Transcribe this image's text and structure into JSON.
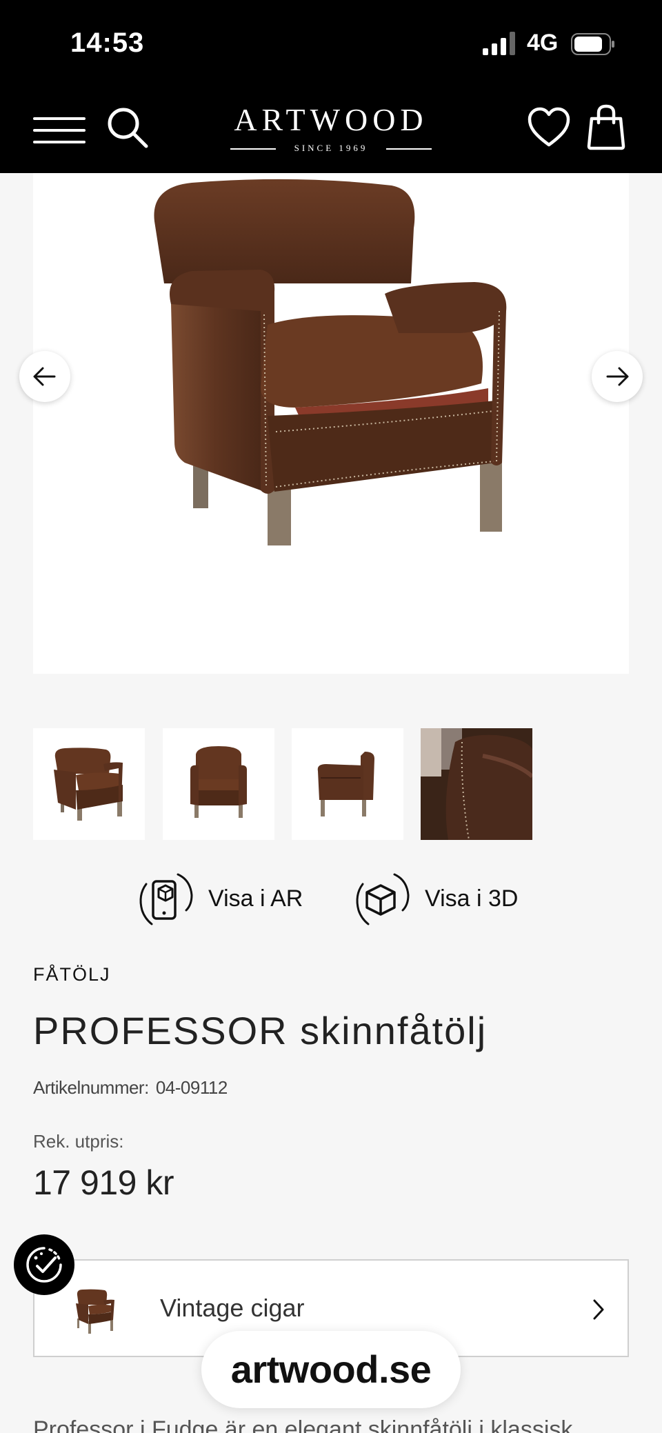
{
  "status_bar": {
    "time": "14:53",
    "network": "4G"
  },
  "header": {
    "logo_main": "ARTWOOD",
    "logo_sub": "SINCE 1969"
  },
  "gallery": {
    "thumbnail_count": 4
  },
  "view_buttons": {
    "ar_label": "Visa i AR",
    "three_d_label": "Visa i 3D"
  },
  "product": {
    "category": "FÅTÖLJ",
    "title": "PROFESSOR skinnfåtölj",
    "article_label": "Artikelnummer:",
    "article_number": "04-09112",
    "price_label": "Rek. utpris:",
    "price": "17 919 kr"
  },
  "variant": {
    "label": "Vintage cigar"
  },
  "url_pill": {
    "text": "artwood.se"
  },
  "description_preview": "Professor i Fudge är en elegant skinnfåtölj i klassisk",
  "colors": {
    "header_bg": "#000000",
    "page_bg": "#f6f6f6",
    "leather": "#5a3220"
  }
}
